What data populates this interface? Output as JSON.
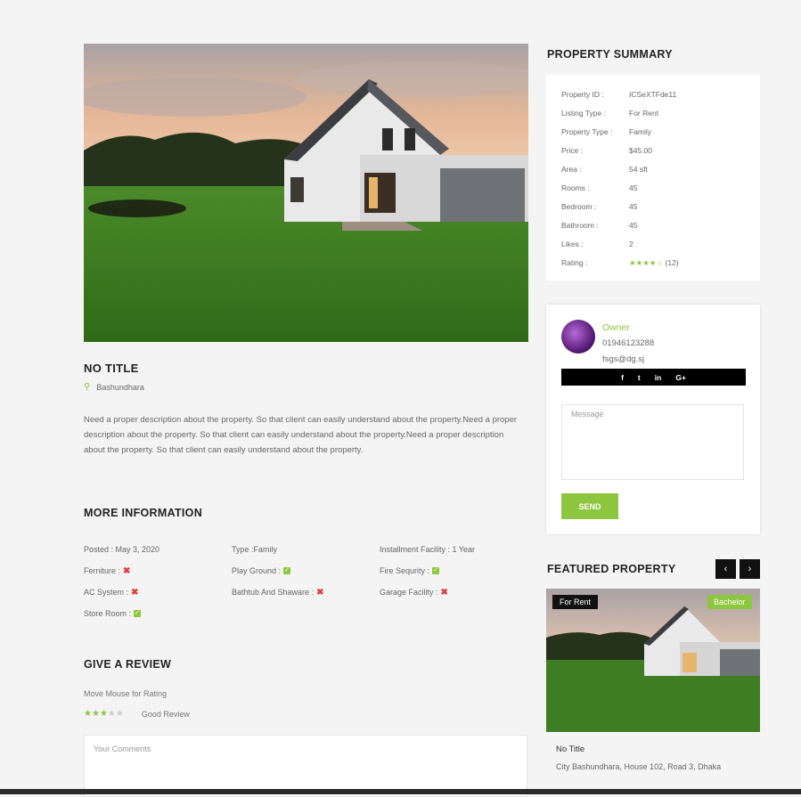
{
  "property": {
    "title": "NO TITLE",
    "location": "Bashundhara",
    "description": "Need a proper description about the property. So that client can easily understand about the property.Need a proper description about the property. So that client can easily understand about the property.Need a proper description about the property. So that client can easily understand about the property."
  },
  "more_info": {
    "heading": "MORE INFORMATION",
    "rows": [
      [
        {
          "label": "Posted : May 3, 2020",
          "status": ""
        },
        {
          "label": "Type :Family",
          "status": ""
        },
        {
          "label": "Installment Facility : 1 Year",
          "status": ""
        }
      ],
      [
        {
          "label": "Ferniture :",
          "status": "no"
        },
        {
          "label": "Play Ground :",
          "status": "yes"
        },
        {
          "label": "Fire Sequrity :",
          "status": "yes"
        }
      ],
      [
        {
          "label": "AC System :",
          "status": "no"
        },
        {
          "label": "Bathtub And Shaware :",
          "status": "no"
        },
        {
          "label": "Garage Facility :",
          "status": "no"
        }
      ],
      [
        {
          "label": "Store Room :",
          "status": "yes"
        }
      ]
    ]
  },
  "review": {
    "heading": "GIVE A REVIEW",
    "hint": "Move Mouse for Rating",
    "rating": 3,
    "max": 5,
    "label": "Good Review",
    "comments_placeholder": "Your Comments"
  },
  "summary": {
    "heading": "PROPERTY SUMMARY",
    "rows": [
      {
        "k": "Property ID :",
        "v": "ICSeXTFde11"
      },
      {
        "k": "Listing Type :",
        "v": "For Rent"
      },
      {
        "k": "Property Type :",
        "v": "Family"
      },
      {
        "k": "Price :",
        "v": "$45.00"
      },
      {
        "k": "Area :",
        "v": "54 sft"
      },
      {
        "k": "Rooms :",
        "v": "45"
      },
      {
        "k": "Bedroom :",
        "v": "45"
      },
      {
        "k": "Bathroom :",
        "v": "45"
      },
      {
        "k": "Likes :",
        "v": "2"
      }
    ],
    "rating_label": "Rating :",
    "rating_stars": 4,
    "rating_count": "(12)"
  },
  "owner": {
    "name": "Owner",
    "phone": "01946123288",
    "email": "fsgs@dg.sj",
    "social": [
      "f",
      "t",
      "in",
      "G+"
    ],
    "message_placeholder": "Message",
    "send_label": "SEND"
  },
  "featured": {
    "heading": "FEATURED PROPERTY",
    "prev": "‹",
    "next": "›",
    "badge_left": "For Rent",
    "badge_right": "Bachelor",
    "title": "No Title",
    "address": "City Bashundhara, House 102, Road 3, Dhaka"
  },
  "colors": {
    "accent": "#8dc63f",
    "dark": "#111111",
    "bg": "#f4f4f4"
  }
}
